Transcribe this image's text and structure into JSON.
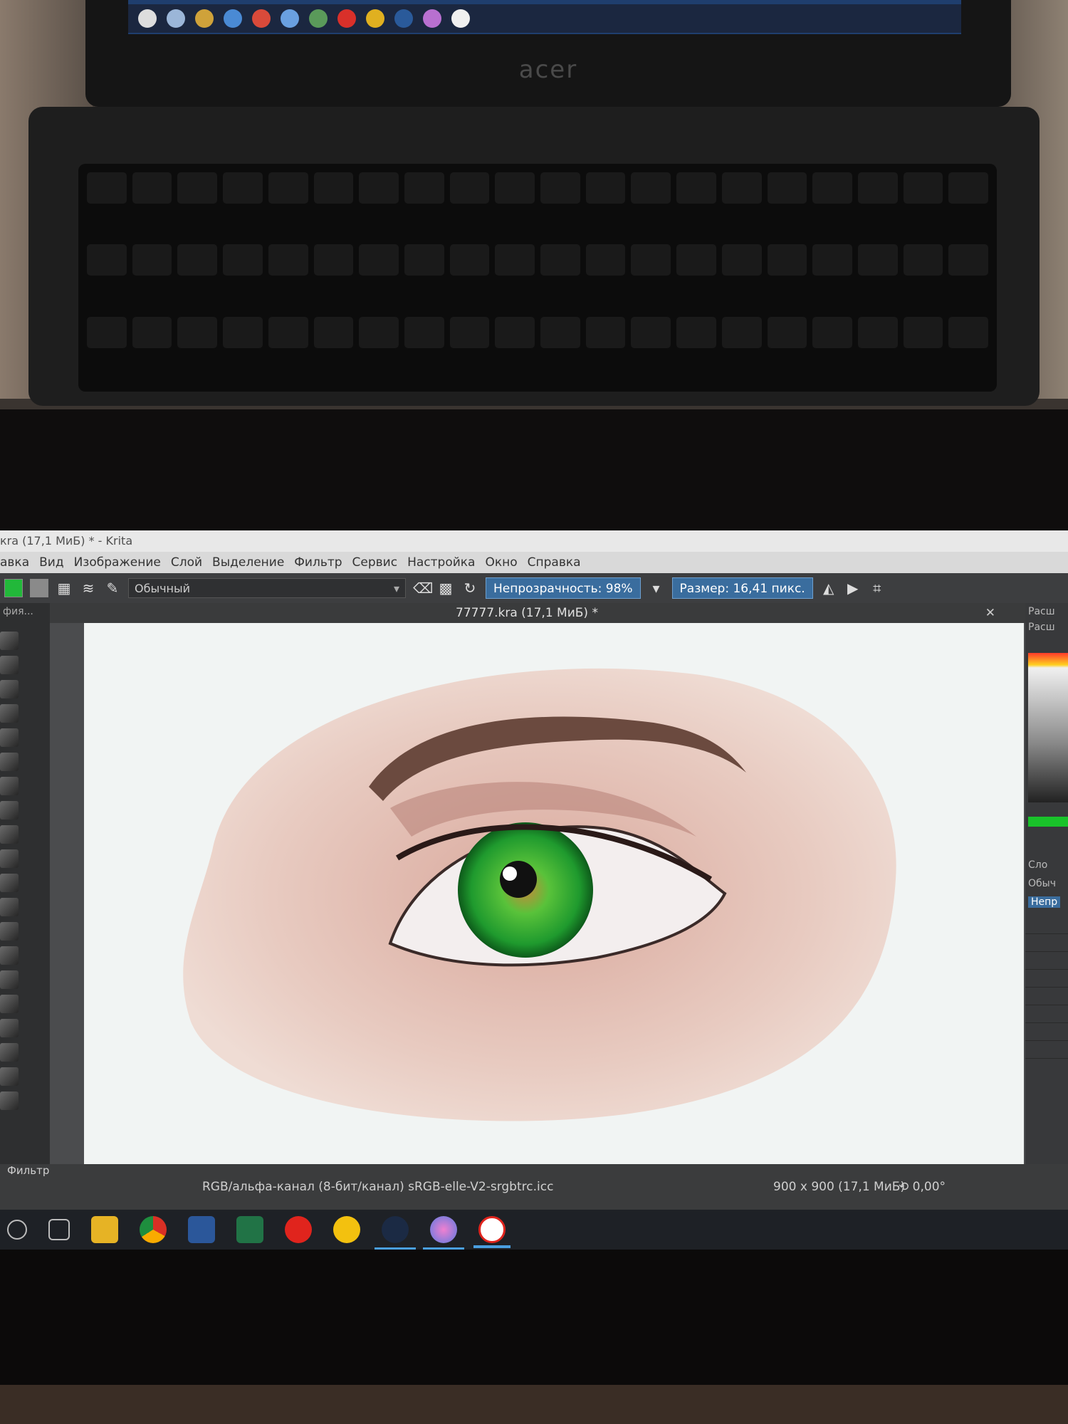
{
  "laptop": {
    "brand": "acer"
  },
  "window": {
    "title": "кra (17,1 МиБ) * - Krita"
  },
  "menu": {
    "items": [
      "авка",
      "Вид",
      "Изображение",
      "Слой",
      "Выделение",
      "Фильтр",
      "Сервис",
      "Настройка",
      "Окно",
      "Справка"
    ]
  },
  "toolbar": {
    "blend_mode": "Обычный",
    "opacity": "Непрозрачность: 98%",
    "size": "Размер: 16,41 пикс."
  },
  "left_dock": {
    "title": "фия...",
    "filter_label": "Фильтр"
  },
  "document": {
    "tab_title": "77777.kra (17,1 МиБ) *"
  },
  "right_dock": {
    "header": "Расш",
    "sub": "Расш",
    "layers_label": "Сло",
    "blend": "Обыч",
    "opacity_short": "Непр"
  },
  "status": {
    "color_space": "RGB/альфа-канал (8-бит/канал)  sRGB-elle-V2-srgbtrc.icc",
    "image_size": "900 x 900 (17,1 МиБ)",
    "rotation": "0,00°"
  },
  "colors": {
    "accent": "#3a6d9e",
    "iris": "#2fa63a",
    "skin": "#e7c7bd",
    "brow": "#6b4a3f"
  },
  "taskbar": {
    "icons": [
      "search-icon",
      "task-view-icon",
      "file-explorer-icon",
      "chrome-icon",
      "word-icon",
      "excel-icon",
      "yandex-icon",
      "miro-icon",
      "steam-icon",
      "krita-icon",
      "yandex-browser-icon"
    ]
  }
}
